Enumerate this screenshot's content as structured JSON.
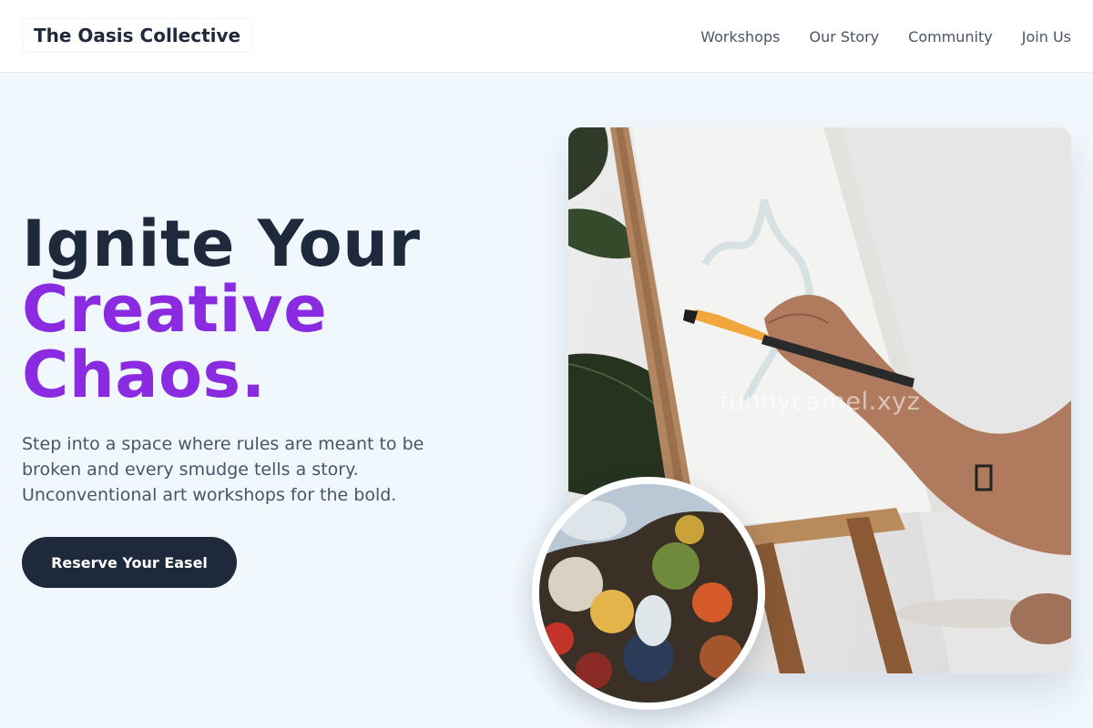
{
  "header": {
    "brand": "The Oasis Collective",
    "nav": [
      "Workshops",
      "Our Story",
      "Community",
      "Join Us"
    ]
  },
  "hero": {
    "title_line1": "Ignite Your",
    "title_accent_line1": "Creative",
    "title_accent_line2": "Chaos.",
    "subtitle": "Step into a space where rules are meant to be broken and every smudge tells a story. Unconventional art workshops for the bold.",
    "cta_label": "Reserve Your Easel"
  },
  "images": {
    "main_photo": "painting-on-easel-photo",
    "watermark": "funnycamel.xyz",
    "circle_photo": "paint-palette-photo"
  },
  "colors": {
    "dark": "#1e293b",
    "accent": "#8a2be2",
    "background": "#f0f7fd"
  }
}
